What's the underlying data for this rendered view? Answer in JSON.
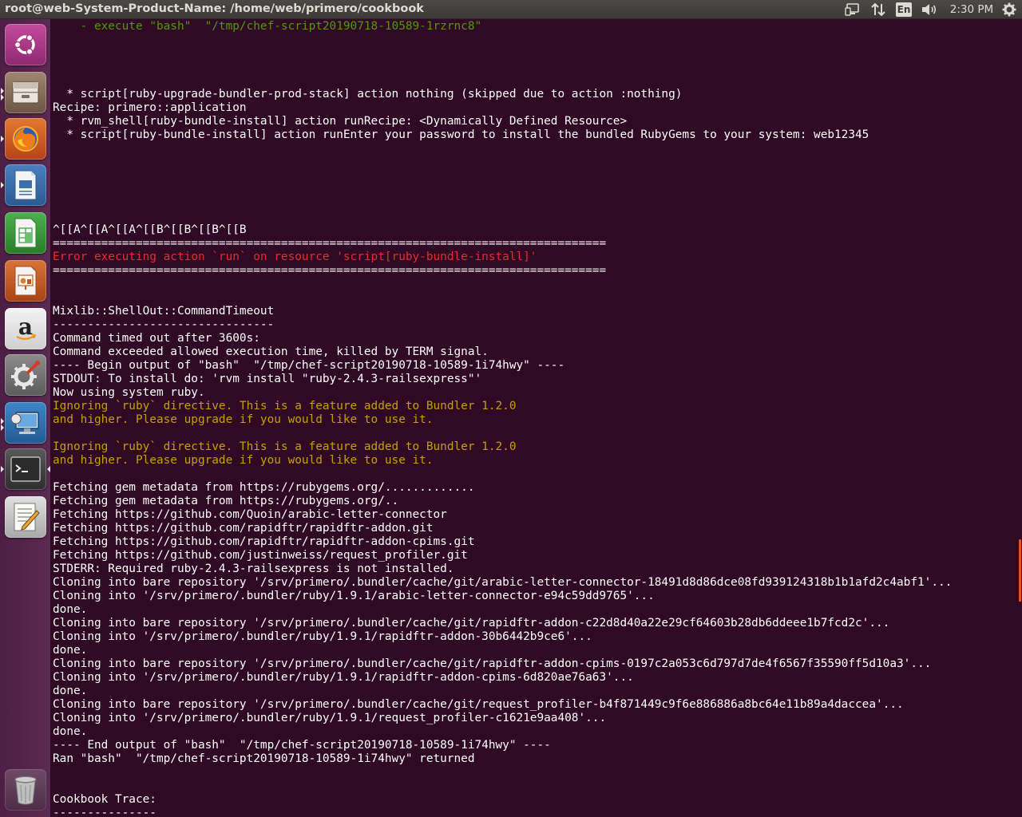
{
  "window": {
    "title": "root@web-System-Product-Name: /home/web/primero/cookbook"
  },
  "panel": {
    "keyboard_layout": "En",
    "clock": "2:30 PM",
    "icons": [
      "network-icon",
      "transfer-arrows-icon",
      "keyboard-layout-icon",
      "volume-icon",
      "system-gear-icon"
    ]
  },
  "launcher": {
    "items": [
      {
        "name": "ubuntu-dash-icon",
        "color": "#b03d8b"
      },
      {
        "name": "files-icon",
        "color": "#8a6f5a"
      },
      {
        "name": "firefox-icon",
        "color": "#d85c1c"
      },
      {
        "name": "writer-icon",
        "color": "#3b6ea8"
      },
      {
        "name": "calc-icon",
        "color": "#3e9a3e"
      },
      {
        "name": "impress-icon",
        "color": "#c1561f"
      },
      {
        "name": "amazon-icon",
        "color": "#e6e6e6"
      },
      {
        "name": "system-settings-icon",
        "color": "#7a7a7a"
      },
      {
        "name": "remote-desktop-icon",
        "color": "#2f6fb0"
      },
      {
        "name": "terminal-icon",
        "color": "#3a3a3a"
      },
      {
        "name": "text-editor-icon",
        "color": "#cfcfcf"
      }
    ],
    "trash": {
      "name": "trash-icon"
    }
  },
  "terminal": {
    "lines": [
      {
        "text": "    - execute \"bash\"  \"/tmp/chef-script20190718-10589-1rzrnc8\"",
        "style": "dim"
      },
      {
        "text": "",
        "style": ""
      },
      {
        "text": "",
        "style": ""
      },
      {
        "text": "",
        "style": ""
      },
      {
        "text": "",
        "style": ""
      },
      {
        "text": "  * script[ruby-upgrade-bundler-prod-stack] action nothing (skipped due to action :nothing)",
        "style": ""
      },
      {
        "text": "Recipe: primero::application",
        "style": ""
      },
      {
        "text": "  * rvm_shell[ruby-bundle-install] action runRecipe: <Dynamically Defined Resource>",
        "style": ""
      },
      {
        "text": "  * script[ruby-bundle-install] action runEnter your password to install the bundled RubyGems to your system: web12345",
        "style": ""
      },
      {
        "text": "",
        "style": ""
      },
      {
        "text": "",
        "style": ""
      },
      {
        "text": "",
        "style": ""
      },
      {
        "text": "",
        "style": ""
      },
      {
        "text": "",
        "style": ""
      },
      {
        "text": "",
        "style": ""
      },
      {
        "text": "^[[A^[[A^[[A^[[B^[[B^[[B^[[B",
        "style": ""
      },
      {
        "text": "================================================================================",
        "style": ""
      },
      {
        "text": "Error executing action `run` on resource 'script[ruby-bundle-install]'",
        "style": "err"
      },
      {
        "text": "================================================================================",
        "style": ""
      },
      {
        "text": "",
        "style": ""
      },
      {
        "text": "",
        "style": ""
      },
      {
        "text": "Mixlib::ShellOut::CommandTimeout",
        "style": ""
      },
      {
        "text": "--------------------------------",
        "style": ""
      },
      {
        "text": "Command timed out after 3600s:",
        "style": ""
      },
      {
        "text": "Command exceeded allowed execution time, killed by TERM signal.",
        "style": ""
      },
      {
        "text": "---- Begin output of \"bash\"  \"/tmp/chef-script20190718-10589-1i74hwy\" ----",
        "style": ""
      },
      {
        "text": "STDOUT: To install do: 'rvm install \"ruby-2.4.3-railsexpress\"'",
        "style": ""
      },
      {
        "text": "Now using system ruby.",
        "style": ""
      },
      {
        "text": "Ignoring `ruby` directive. This is a feature added to Bundler 1.2.0",
        "style": "warn"
      },
      {
        "text": "and higher. Please upgrade if you would like to use it.",
        "style": "warn"
      },
      {
        "text": "",
        "style": ""
      },
      {
        "text": "Ignoring `ruby` directive. This is a feature added to Bundler 1.2.0",
        "style": "warn"
      },
      {
        "text": "and higher. Please upgrade if you would like to use it.",
        "style": "warn"
      },
      {
        "text": "",
        "style": ""
      },
      {
        "text": "Fetching gem metadata from https://rubygems.org/.............",
        "style": ""
      },
      {
        "text": "Fetching gem metadata from https://rubygems.org/..",
        "style": ""
      },
      {
        "text": "Fetching https://github.com/Quoin/arabic-letter-connector",
        "style": ""
      },
      {
        "text": "Fetching https://github.com/rapidftr/rapidftr-addon.git",
        "style": ""
      },
      {
        "text": "Fetching https://github.com/rapidftr/rapidftr-addon-cpims.git",
        "style": ""
      },
      {
        "text": "Fetching https://github.com/justinweiss/request_profiler.git",
        "style": ""
      },
      {
        "text": "STDERR: Required ruby-2.4.3-railsexpress is not installed.",
        "style": ""
      },
      {
        "text": "Cloning into bare repository '/srv/primero/.bundler/cache/git/arabic-letter-connector-18491d8d86dce08fd939124318b1b1afd2c4abf1'...",
        "style": ""
      },
      {
        "text": "Cloning into '/srv/primero/.bundler/ruby/1.9.1/arabic-letter-connector-e94c59dd9765'...",
        "style": ""
      },
      {
        "text": "done.",
        "style": ""
      },
      {
        "text": "Cloning into bare repository '/srv/primero/.bundler/cache/git/rapidftr-addon-c22d8d40a22e29cf64603b28db6ddeee1b7fcd2c'...",
        "style": ""
      },
      {
        "text": "Cloning into '/srv/primero/.bundler/ruby/1.9.1/rapidftr-addon-30b6442b9ce6'...",
        "style": ""
      },
      {
        "text": "done.",
        "style": ""
      },
      {
        "text": "Cloning into bare repository '/srv/primero/.bundler/cache/git/rapidftr-addon-cpims-0197c2a053c6d797d7de4f6567f35590ff5d10a3'...",
        "style": ""
      },
      {
        "text": "Cloning into '/srv/primero/.bundler/ruby/1.9.1/rapidftr-addon-cpims-6d820ae76a63'...",
        "style": ""
      },
      {
        "text": "done.",
        "style": ""
      },
      {
        "text": "Cloning into bare repository '/srv/primero/.bundler/cache/git/request_profiler-b4f871449c9f6e886886a8bc64e11b89a4daccea'...",
        "style": ""
      },
      {
        "text": "Cloning into '/srv/primero/.bundler/ruby/1.9.1/request_profiler-c1621e9aa408'...",
        "style": ""
      },
      {
        "text": "done.",
        "style": ""
      },
      {
        "text": "---- End output of \"bash\"  \"/tmp/chef-script20190718-10589-1i74hwy\" ----",
        "style": ""
      },
      {
        "text": "Ran \"bash\"  \"/tmp/chef-script20190718-10589-1i74hwy\" returned",
        "style": ""
      },
      {
        "text": "",
        "style": ""
      },
      {
        "text": "",
        "style": ""
      },
      {
        "text": "Cookbook Trace:",
        "style": ""
      },
      {
        "text": "---------------",
        "style": ""
      }
    ]
  },
  "colors": {
    "terminal_bg": "#300a24",
    "error_text": "#ef2929",
    "warning_text": "#c4a000",
    "accent": "#e95420"
  }
}
